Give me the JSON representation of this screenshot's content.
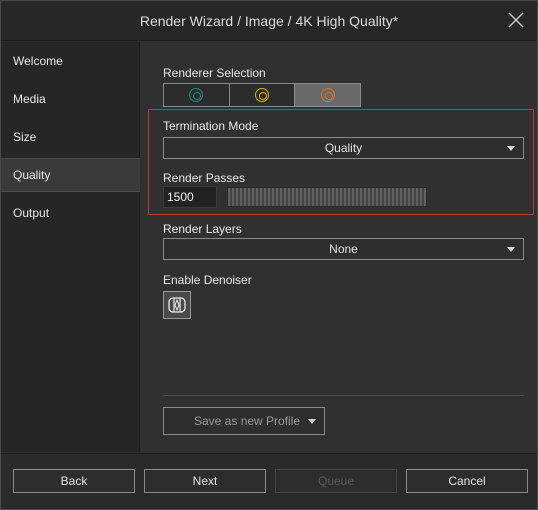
{
  "window": {
    "title": "Render Wizard / Image / 4K High Quality*"
  },
  "sidebar": {
    "items": [
      {
        "label": "Welcome"
      },
      {
        "label": "Media"
      },
      {
        "label": "Size"
      },
      {
        "label": "Quality",
        "active": true
      },
      {
        "label": "Output"
      }
    ]
  },
  "renderer": {
    "label": "Renderer Selection",
    "options": [
      {
        "icon": "teal-ring-icon",
        "color": "#1a8a8a"
      },
      {
        "icon": "yellow-ring-icon",
        "color": "#d9b400"
      },
      {
        "icon": "orange-ring-icon",
        "color": "#e0701a",
        "selected": true
      }
    ]
  },
  "termination": {
    "label": "Termination Mode",
    "value": "Quality"
  },
  "passes": {
    "label": "Render Passes",
    "value": "1500"
  },
  "layers": {
    "label": "Render Layers",
    "value": "None"
  },
  "denoiser": {
    "label": "Enable Denoiser",
    "icon": "denoiser-icon"
  },
  "profile": {
    "label": "Save as new Profile"
  },
  "footer": {
    "back": "Back",
    "next": "Next",
    "queue": "Queue",
    "cancel": "Cancel"
  },
  "colors": {
    "highlight_border": "#c0373a",
    "accent": "#e0701a"
  }
}
